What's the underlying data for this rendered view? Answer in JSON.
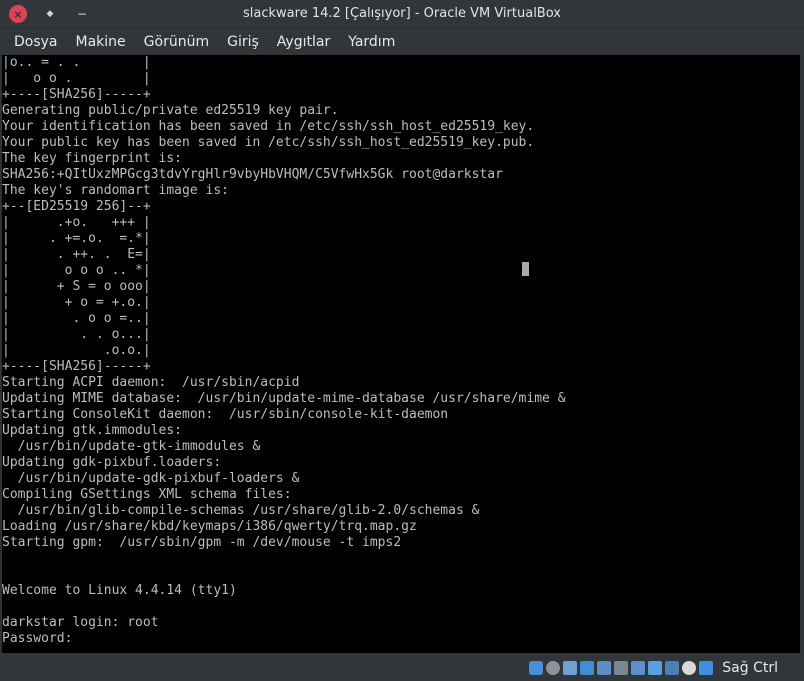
{
  "window": {
    "title": "slackware 14.2 [Çalışıyor] - Oracle VM VirtualBox",
    "close_glyph": "×",
    "pin_glyph": "◆",
    "min_glyph": "−"
  },
  "menu": {
    "items": [
      "Dosya",
      "Makine",
      "Görünüm",
      "Giriş",
      "Aygıtlar",
      "Yardım"
    ]
  },
  "console": {
    "lines": [
      "|o.. = . .        |",
      "|   o o .         |",
      "+----[SHA256]-----+",
      "Generating public/private ed25519 key pair.",
      "Your identification has been saved in /etc/ssh/ssh_host_ed25519_key.",
      "Your public key has been saved in /etc/ssh/ssh_host_ed25519_key.pub.",
      "The key fingerprint is:",
      "SHA256:+QItUxzMPGcg3tdvYrgHlr9vbyHbVHQM/C5VfwHx5Gk root@darkstar",
      "The key's randomart image is:",
      "+--[ED25519 256]--+",
      "|      .+o.   +++ |",
      "|     . +=.o.  =.*|",
      "|      . ++. .  E=|",
      "|       o o o .. *|",
      "|      + S = o ooo|",
      "|       + o = +.o.|",
      "|        . o o =..|",
      "|         . . o...|",
      "|            .o.o.|",
      "+----[SHA256]-----+",
      "Starting ACPI daemon:  /usr/sbin/acpid",
      "Updating MIME database:  /usr/bin/update-mime-database /usr/share/mime &",
      "Starting ConsoleKit daemon:  /usr/sbin/console-kit-daemon",
      "Updating gtk.immodules:",
      "  /usr/bin/update-gtk-immodules &",
      "Updating gdk-pixbuf.loaders:",
      "  /usr/bin/update-gdk-pixbuf-loaders &",
      "Compiling GSettings XML schema files:",
      "  /usr/bin/glib-compile-schemas /usr/share/glib-2.0/schemas &",
      "Loading /usr/share/kbd/keymaps/i386/qwerty/trq.map.gz",
      "Starting gpm:  /usr/sbin/gpm -m /dev/mouse -t imps2",
      "",
      "",
      "Welcome to Linux 4.4.14 (tty1)",
      "",
      "darkstar login: root",
      "Password: "
    ]
  },
  "statusbar": {
    "icons": [
      "disk-icon",
      "optical-icon",
      "audio-icon",
      "network-icon",
      "usb-icon",
      "shared-folder-icon",
      "display-icon",
      "record-icon",
      "cpu-icon",
      "mouse-integration-icon",
      "keyboard-capture-icon"
    ],
    "host_key": "Sağ Ctrl"
  },
  "colors": {
    "chrome": "#31363b",
    "console_bg": "#000000",
    "console_fg": "#bdbdbd",
    "close_button": "#da4453"
  }
}
